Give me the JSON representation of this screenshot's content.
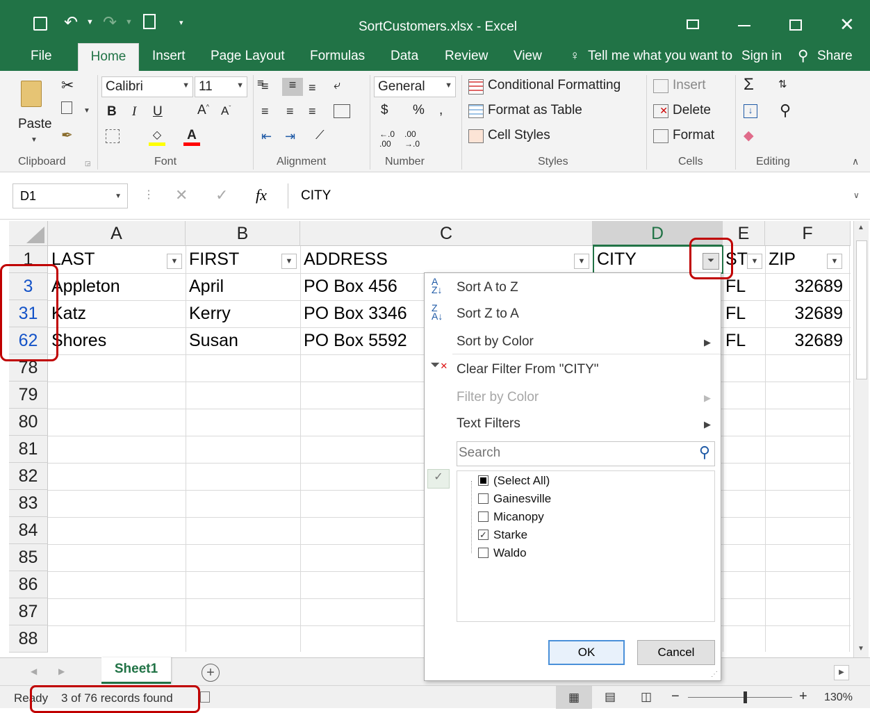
{
  "window": {
    "title": "SortCustomers.xlsx - Excel"
  },
  "tabs": [
    "File",
    "Home",
    "Insert",
    "Page Layout",
    "Formulas",
    "Data",
    "Review",
    "View"
  ],
  "tell_me": "Tell me what you want to do",
  "sign_in": "Sign in",
  "share": "Share",
  "ribbon": {
    "paste": "Paste",
    "font_name": "Calibri",
    "font_size": "11",
    "number_format": "General",
    "conditional_formatting": "Conditional Formatting",
    "format_as_table": "Format as Table",
    "cell_styles": "Cell Styles",
    "insert": "Insert",
    "delete": "Delete",
    "format": "Format",
    "groups": [
      "Clipboard",
      "Font",
      "Alignment",
      "Number",
      "Styles",
      "Cells",
      "Editing"
    ]
  },
  "formula_bar": {
    "name_box": "D1",
    "fx": "fx",
    "content": "CITY"
  },
  "columns": [
    "A",
    "B",
    "C",
    "D",
    "E",
    "F"
  ],
  "header_row": {
    "num": "1",
    "last": "LAST",
    "first": "FIRST",
    "address": "ADDRESS",
    "city": "CITY",
    "st": "ST",
    "zip": "ZIP"
  },
  "rows": [
    {
      "num": "3",
      "last": "Appleton",
      "first": "April",
      "address": "PO Box 456",
      "st": "FL",
      "zip": "32689"
    },
    {
      "num": "31",
      "last": "Katz",
      "first": "Kerry",
      "address": "PO Box 3346",
      "st": "FL",
      "zip": "32689"
    },
    {
      "num": "62",
      "last": "Shores",
      "first": "Susan",
      "address": "PO Box 5592",
      "st": "FL",
      "zip": "32689"
    }
  ],
  "empty_rows": [
    "78",
    "79",
    "80",
    "81",
    "82",
    "83",
    "84",
    "85",
    "86",
    "87",
    "88"
  ],
  "filter_menu": {
    "sort_az": "Sort A to Z",
    "sort_za": "Sort Z to A",
    "sort_color": "Sort by Color",
    "clear_filter": "Clear Filter From \"CITY\"",
    "filter_color": "Filter by Color",
    "text_filters": "Text Filters",
    "search_placeholder": "Search",
    "items": [
      {
        "label": "(Select All)",
        "state": "partial"
      },
      {
        "label": "Gainesville",
        "state": "unchecked"
      },
      {
        "label": "Micanopy",
        "state": "unchecked"
      },
      {
        "label": "Starke",
        "state": "checked"
      },
      {
        "label": "Waldo",
        "state": "unchecked"
      }
    ],
    "ok": "OK",
    "cancel": "Cancel"
  },
  "sheet_tab": "Sheet1",
  "status": {
    "ready": "Ready",
    "records": "3 of 76 records found",
    "zoom": "130%"
  }
}
